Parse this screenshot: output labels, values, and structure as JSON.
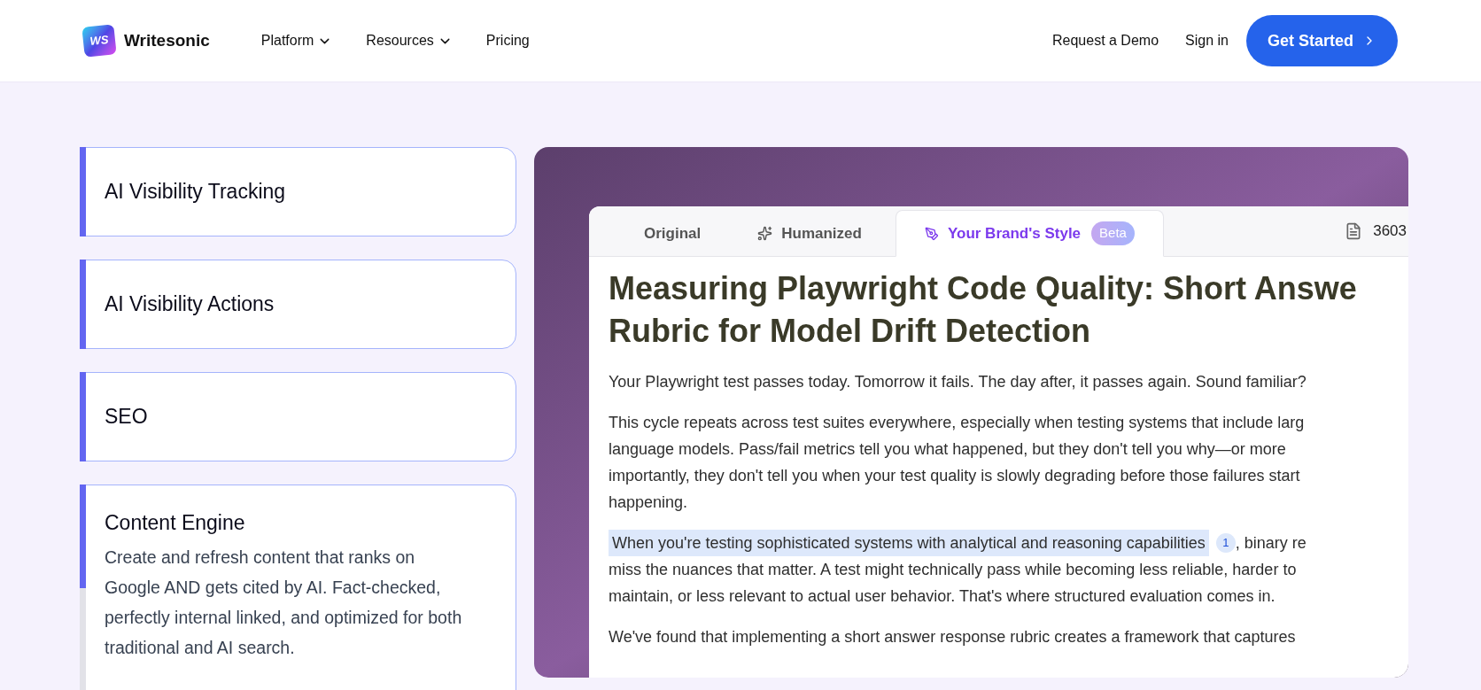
{
  "header": {
    "brand": {
      "logo_text": "WS",
      "name": "Writesonic"
    },
    "nav": [
      {
        "label": "Platform",
        "has_menu": true
      },
      {
        "label": "Resources",
        "has_menu": true
      },
      {
        "label": "Pricing",
        "has_menu": false
      }
    ],
    "actions": {
      "demo": "Request a Demo",
      "sign_in": "Sign in",
      "cta": "Get Started"
    }
  },
  "features": [
    {
      "title": "AI Visibility Tracking",
      "expanded": false
    },
    {
      "title": "AI Visibility Actions",
      "expanded": false
    },
    {
      "title": "SEO",
      "expanded": false
    },
    {
      "title": "Content Engine",
      "expanded": true,
      "description": "Create and refresh content that ranks on Google AND gets cited by AI. Fact-checked, perfectly internal linked, and optimized for both traditional and AI search.",
      "level": 0.45
    }
  ],
  "preview": {
    "tabs": [
      {
        "label": "Original",
        "kind": "plain",
        "selected": false
      },
      {
        "label": "Humanized",
        "kind": "sparkle",
        "selected": false
      },
      {
        "label": "Your Brand's Style",
        "kind": "brand",
        "badge": "Beta",
        "selected": true
      }
    ],
    "word_count": "3603",
    "title_lines": [
      "Measuring Playwright Code Quality: Short Answe",
      "Rubric for Model Drift Detection"
    ],
    "paragraphs": [
      {
        "lines": [
          "Your Playwright test passes today. Tomorrow it fails. The day after, it passes again. Sound familiar?"
        ]
      },
      {
        "lines": [
          "This cycle repeats across test suites everywhere, especially when testing systems that include larg",
          "language models. Pass/fail metrics tell you what happened, but they don't tell you why—or more",
          "importantly, they don't tell you when your test quality is slowly degrading before those failures start",
          "happening."
        ]
      },
      {
        "highlight": {
          "text": "When you're testing sophisticated systems with analytical and reasoning capabilities",
          "citation": "1"
        },
        "lines": [
          ", binary re",
          "miss the nuances that matter. A test might technically pass while becoming less reliable, harder to",
          "maintain, or less relevant to actual user behavior. That's where structured evaluation comes in."
        ]
      },
      {
        "lines": [
          "We've found that implementing a short answer response rubric creates a framework that captures"
        ]
      }
    ]
  }
}
